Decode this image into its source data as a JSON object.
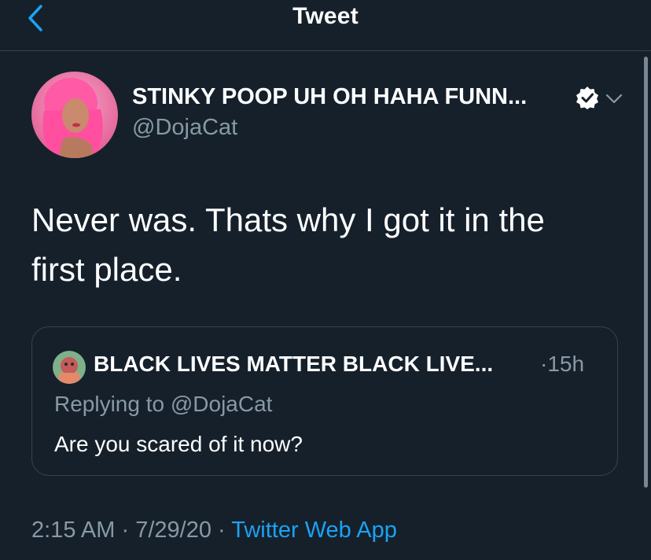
{
  "header": {
    "title": "Tweet",
    "back_icon": "chevron-left-icon"
  },
  "tweet": {
    "author_name": "STINKY POOP UH OH HAHA FUNN...",
    "author_handle": "@DojaCat",
    "verified_icon": "verified-badge-icon",
    "menu_icon": "chevron-down-icon",
    "text": "Never was. Thats why I got it in the first place.",
    "time": "2:15 AM",
    "separator": "·",
    "date": "7/29/20",
    "source": "Twitter Web App"
  },
  "quoted_tweet": {
    "author_name": "BLACK LIVES MATTER BLACK LIVE...",
    "time": "·15h",
    "replying_to": "Replying to @DojaCat",
    "text": "Are you scared of it now?"
  },
  "colors": {
    "background": "#15202b",
    "accent": "#1da1f2",
    "muted_text": "#8899a6",
    "border": "#38444d"
  }
}
